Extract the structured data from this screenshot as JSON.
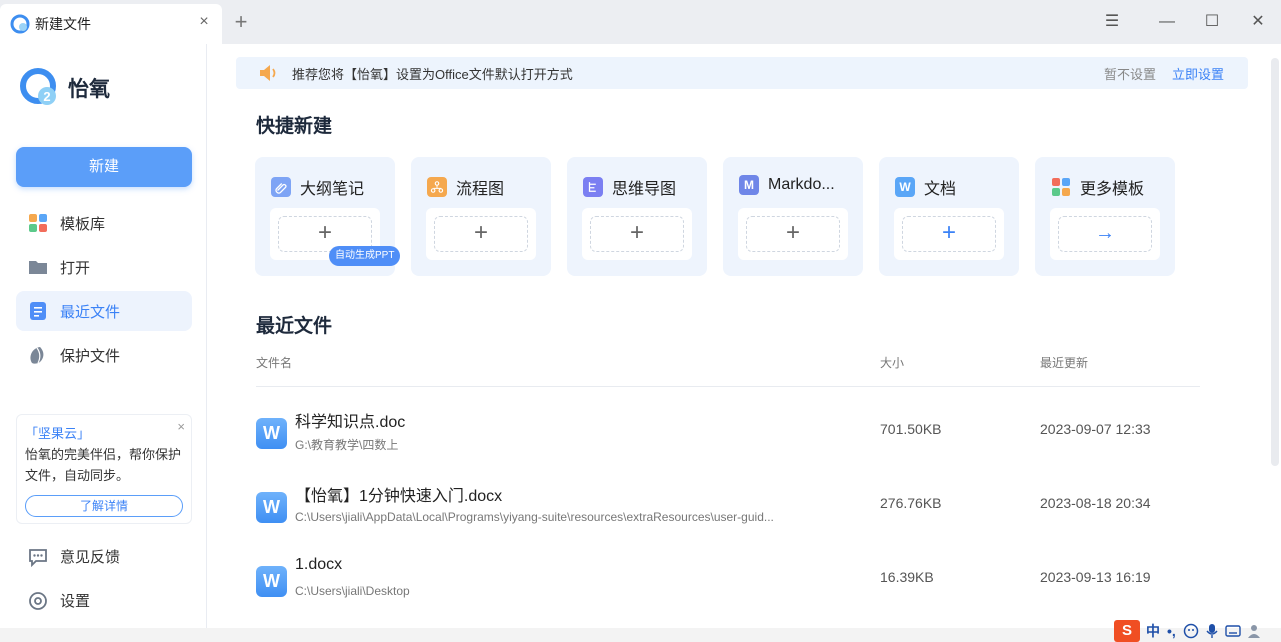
{
  "tab": {
    "title": "新建文件",
    "close": "×",
    "new_tab": "+"
  },
  "window": {
    "menu": "☰",
    "minimize": "—",
    "maximize": "☐",
    "close": "✕"
  },
  "brand": {
    "name": "怡氧"
  },
  "sidebar": {
    "new_button": "新建",
    "items": [
      {
        "label": "模板库",
        "icon": "template-icon"
      },
      {
        "label": "打开",
        "icon": "folder-icon"
      },
      {
        "label": "最近文件",
        "icon": "document-icon",
        "active": true
      },
      {
        "label": "保护文件",
        "icon": "shield-icon"
      }
    ],
    "promo": {
      "title": "「坚果云」",
      "text": "怡氧的完美伴侣，帮你保护文件，自动同步。",
      "button": "了解详情",
      "close": "×"
    },
    "bottom": [
      {
        "label": "意见反馈",
        "icon": "feedback-icon"
      },
      {
        "label": "设置",
        "icon": "settings-icon"
      }
    ]
  },
  "banner": {
    "text": "推荐您将【怡氧】设置为Office文件默认打开方式",
    "later": "暂不设置",
    "set_now": "立即设置"
  },
  "quick_create": {
    "title": "快捷新建",
    "cards": [
      {
        "label": "大纲笔记",
        "icon": "outline-icon",
        "color": "#7ea4f5",
        "action": "+",
        "tag": "自动生成PPT"
      },
      {
        "label": "流程图",
        "icon": "flowchart-icon",
        "color": "#f5a84e",
        "action": "+"
      },
      {
        "label": "思维导图",
        "icon": "mindmap-icon",
        "color": "#7b7ff2",
        "action": "+"
      },
      {
        "label": "Markdo...",
        "icon": "markdown-icon",
        "color": "#6f86e8",
        "glyph": "M",
        "action": "+"
      },
      {
        "label": "文档",
        "icon": "word-icon",
        "color": "#5aa6f7",
        "glyph": "W",
        "action": "+"
      },
      {
        "label": "更多模板",
        "icon": "more-templates-icon",
        "color": "#f26d5b",
        "action": "→"
      }
    ]
  },
  "recent": {
    "title": "最近文件",
    "columns": {
      "name": "文件名",
      "size": "大小",
      "updated": "最近更新"
    },
    "rows": [
      {
        "icon": "W",
        "name": "科学知识点.doc",
        "path": "G:\\教育教学\\四数上",
        "size": "701.50KB",
        "updated": "2023-09-07 12:33"
      },
      {
        "icon": "W",
        "name": "【怡氧】1分钟快速入门.docx",
        "path": "C:\\Users\\jiali\\AppData\\Local\\Programs\\yiyang-suite\\resources\\extraResources\\user-guid...",
        "size": "276.76KB",
        "updated": "2023-08-18 20:34"
      },
      {
        "icon": "W",
        "name": "1.docx",
        "path": "C:\\Users\\jiali\\Desktop",
        "size": "16.39KB",
        "updated": "2023-09-13 16:19"
      }
    ]
  },
  "taskbar": {
    "ime_logo": "S",
    "ime_mode": "中",
    "ime_punct": "•,"
  },
  "colors": {
    "accent": "#3b82f6",
    "primary_button": "#5b9ef9",
    "card_bg": "#eef4fd"
  }
}
